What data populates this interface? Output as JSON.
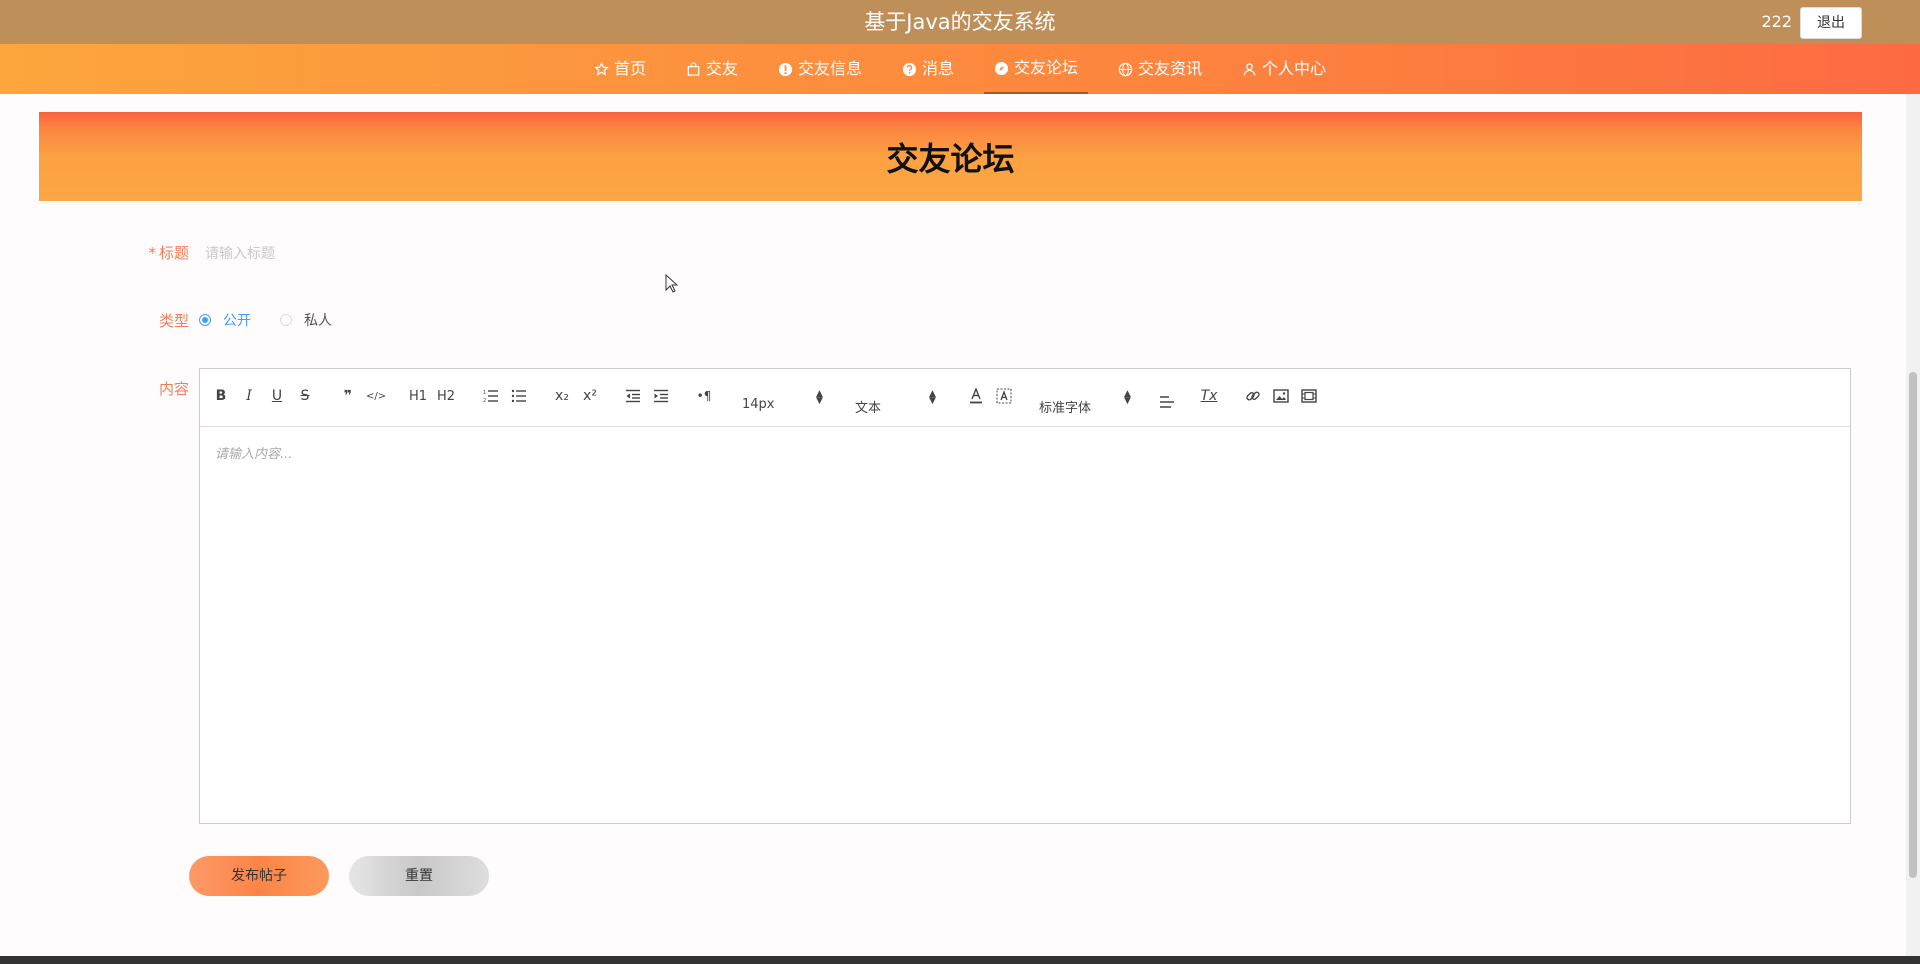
{
  "header": {
    "title": "基于Java的交友系统",
    "username": "222",
    "logout_label": "退出"
  },
  "nav": {
    "items": [
      {
        "label": "首页",
        "icon": "star-icon"
      },
      {
        "label": "交友",
        "icon": "bag-icon"
      },
      {
        "label": "交友信息",
        "icon": "info-icon"
      },
      {
        "label": "消息",
        "icon": "question-icon"
      },
      {
        "label": "交友论坛",
        "icon": "compass-icon",
        "active": true
      },
      {
        "label": "交友资讯",
        "icon": "globe-icon"
      },
      {
        "label": "个人中心",
        "icon": "user-icon"
      }
    ]
  },
  "banner": {
    "title": "交友论坛"
  },
  "form": {
    "title_label": "标题",
    "title_required_mark": "*",
    "title_placeholder": "请输入标题",
    "title_value": "",
    "type_label": "类型",
    "type_options": [
      {
        "label": "公开",
        "checked": true
      },
      {
        "label": "私人",
        "checked": false
      }
    ],
    "content_label": "内容",
    "content_placeholder": "请输入内容..."
  },
  "editor": {
    "font_size": "14px",
    "header_select": "文本",
    "font_family": "标准字体",
    "tools": {
      "bold": "B",
      "italic": "I",
      "underline": "U",
      "strike": "S",
      "quote": "❞",
      "code": "</>",
      "h1": "H1",
      "h2": "H2",
      "sub": "x₂",
      "sup": "x²",
      "direction": "•¶",
      "clean": "Tx"
    }
  },
  "buttons": {
    "submit": "发布帖子",
    "reset": "重置"
  },
  "colors": {
    "topbar": "#bf8f5a",
    "nav_start": "#fca63d",
    "nav_end": "#fd6a42",
    "label": "#f0805a",
    "radio_active": "#409eff"
  }
}
